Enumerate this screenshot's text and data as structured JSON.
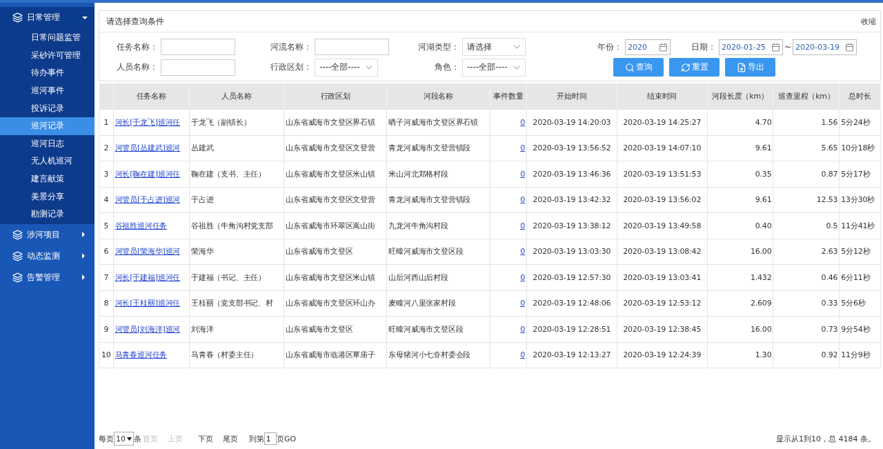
{
  "sidebar": {
    "groups": [
      {
        "label": "日常管理",
        "expanded": true,
        "items": [
          {
            "label": "日常问题监管",
            "selected": false
          },
          {
            "label": "采砂许可管理",
            "selected": false
          },
          {
            "label": "待办事件",
            "selected": false
          },
          {
            "label": "巡河事件",
            "selected": false
          },
          {
            "label": "投诉记录",
            "selected": false
          },
          {
            "label": "巡河记录",
            "selected": true
          },
          {
            "label": "巡河日志",
            "selected": false
          },
          {
            "label": "无人机巡河",
            "selected": false
          },
          {
            "label": "建言献策",
            "selected": false
          },
          {
            "label": "美景分享",
            "selected": false
          },
          {
            "label": "勘测记录",
            "selected": false
          }
        ]
      },
      {
        "label": "涉河项目",
        "expanded": false
      },
      {
        "label": "动态监测",
        "expanded": false
      },
      {
        "label": "告警管理",
        "expanded": false
      }
    ]
  },
  "filter": {
    "title": "请选择查询条件",
    "collapse": "收缩",
    "rows": [
      [
        {
          "kind": "text",
          "label": "任务名称："
        },
        {
          "kind": "text",
          "label": "河流名称："
        },
        {
          "kind": "select",
          "label": "河湖类型：",
          "value": "请选择"
        },
        {
          "kind": "date",
          "label": "年份：",
          "value": "2020"
        },
        {
          "kind": "range",
          "label": "日期：",
          "value": "2020-01-25",
          "separator": "~",
          "value_to": "2020-03-19"
        }
      ],
      [
        {
          "kind": "text",
          "label": "人员名称："
        },
        {
          "kind": "select",
          "label": "行政区划：",
          "value": "----全部----"
        },
        {
          "kind": "select",
          "label": "角色：",
          "value": "----全部----"
        }
      ]
    ],
    "buttons": [
      {
        "kind": "search",
        "label": "查询"
      },
      {
        "kind": "reset",
        "label": "重置"
      },
      {
        "kind": "export",
        "label": "导出"
      }
    ]
  },
  "table": {
    "columns": [
      "",
      "任务名称",
      "人员名称",
      "行政区划",
      "河段名称",
      "事件数量",
      "开始时间",
      "结束时间",
      "河段长度（km）",
      "巡查里程（km）",
      "总时长"
    ],
    "rows": [
      [
        "1",
        "河长[于龙飞]巡河任",
        "于龙飞（副镇长）",
        "山东省威海市文登区界石镇",
        "晒子河威海市文登区界石镇",
        "0",
        "2020-03-19 14:20:03",
        "2020-03-19 14:25:27",
        "4.70",
        "1.56",
        "5分24秒"
      ],
      [
        "2",
        "河管员[丛建武]巡河",
        "丛建武",
        "山东省威海市文登区文登营",
        "青龙河威海市文登营镇段",
        "0",
        "2020-03-19 13:56:52",
        "2020-03-19 14:07:10",
        "9.61",
        "5.65",
        "10分18秒"
      ],
      [
        "3",
        "河长[鞠在建]巡河任",
        "鞠在建（支书、主任）",
        "山东省威海市文登区米山镇",
        "米山河北郑格村段",
        "0",
        "2020-03-19 13:46:36",
        "2020-03-19 13:51:53",
        "0.35",
        "0.87",
        "5分17秒"
      ],
      [
        "4",
        "河管员[于占进]巡河",
        "于占进",
        "山东省威海市文登区文登营",
        "青龙河威海市文登营镇段",
        "0",
        "2020-03-19 13:42:32",
        "2020-03-19 13:56:02",
        "9.61",
        "12.53",
        "13分30秒"
      ],
      [
        "5",
        "谷祖胜巡河任务",
        "谷祖胜（牛角沟村党支部",
        "山东省威海市环翠区嵩山街",
        "九龙河牛角沟村段",
        "0",
        "2020-03-19 13:38:12",
        "2020-03-19 13:49:58",
        "0.40",
        "0.5",
        "11分41秒"
      ],
      [
        "6",
        "河管员[荣海华]巡河",
        "荣海华",
        "山东省威海市文登区",
        "旺疃河威海市文登区段",
        "0",
        "2020-03-19 13:03:30",
        "2020-03-19 13:08:42",
        "16.00",
        "2.63",
        "5分12秒"
      ],
      [
        "7",
        "河长[于建福]巡河任",
        "于建福（书记、主任）",
        "山东省威海市文登区米山镇",
        "山后河西山后村段",
        "0",
        "2020-03-19 12:57:30",
        "2020-03-19 13:03:41",
        "1.432",
        "0.46",
        "6分11秒"
      ],
      [
        "8",
        "河长[王桂丽]巡河任",
        "王桂丽（党支部书记、村",
        "山东省威海市文登区环山办",
        "麦疃河八里张家村段",
        "0",
        "2020-03-19 12:48:06",
        "2020-03-19 12:53:12",
        "2.609",
        "0.33",
        "5分6秒"
      ],
      [
        "9",
        "河管员[刘海洋]巡河",
        "刘海洋",
        "山东省威海市文登区",
        "旺疃河威海市文登区段",
        "0",
        "2020-03-19 12:28:51",
        "2020-03-19 12:38:45",
        "16.00",
        "0.73",
        "9分54秒"
      ],
      [
        "10",
        "马青春巡河任务",
        "马青春（村委主任）",
        "山东省威海市临港区草庙子",
        "东母猪河小七夼村委会段",
        "0",
        "2020-03-19 12:13:27",
        "2020-03-19 12:24:39",
        "1.30",
        "0.92",
        "11分9秒"
      ]
    ]
  },
  "pager": {
    "per_page_label": "每页",
    "per_page": "10",
    "unit": "条",
    "links": [
      {
        "label": "首页",
        "disabled": true
      },
      {
        "label": "上页",
        "disabled": true
      },
      {
        "label": "下页",
        "disabled": false
      },
      {
        "label": "尾页",
        "disabled": false
      }
    ],
    "goto_label": "到第",
    "page": "1",
    "go_label": "页GO",
    "summary": "显示从1到10，总 4184 条。"
  }
}
